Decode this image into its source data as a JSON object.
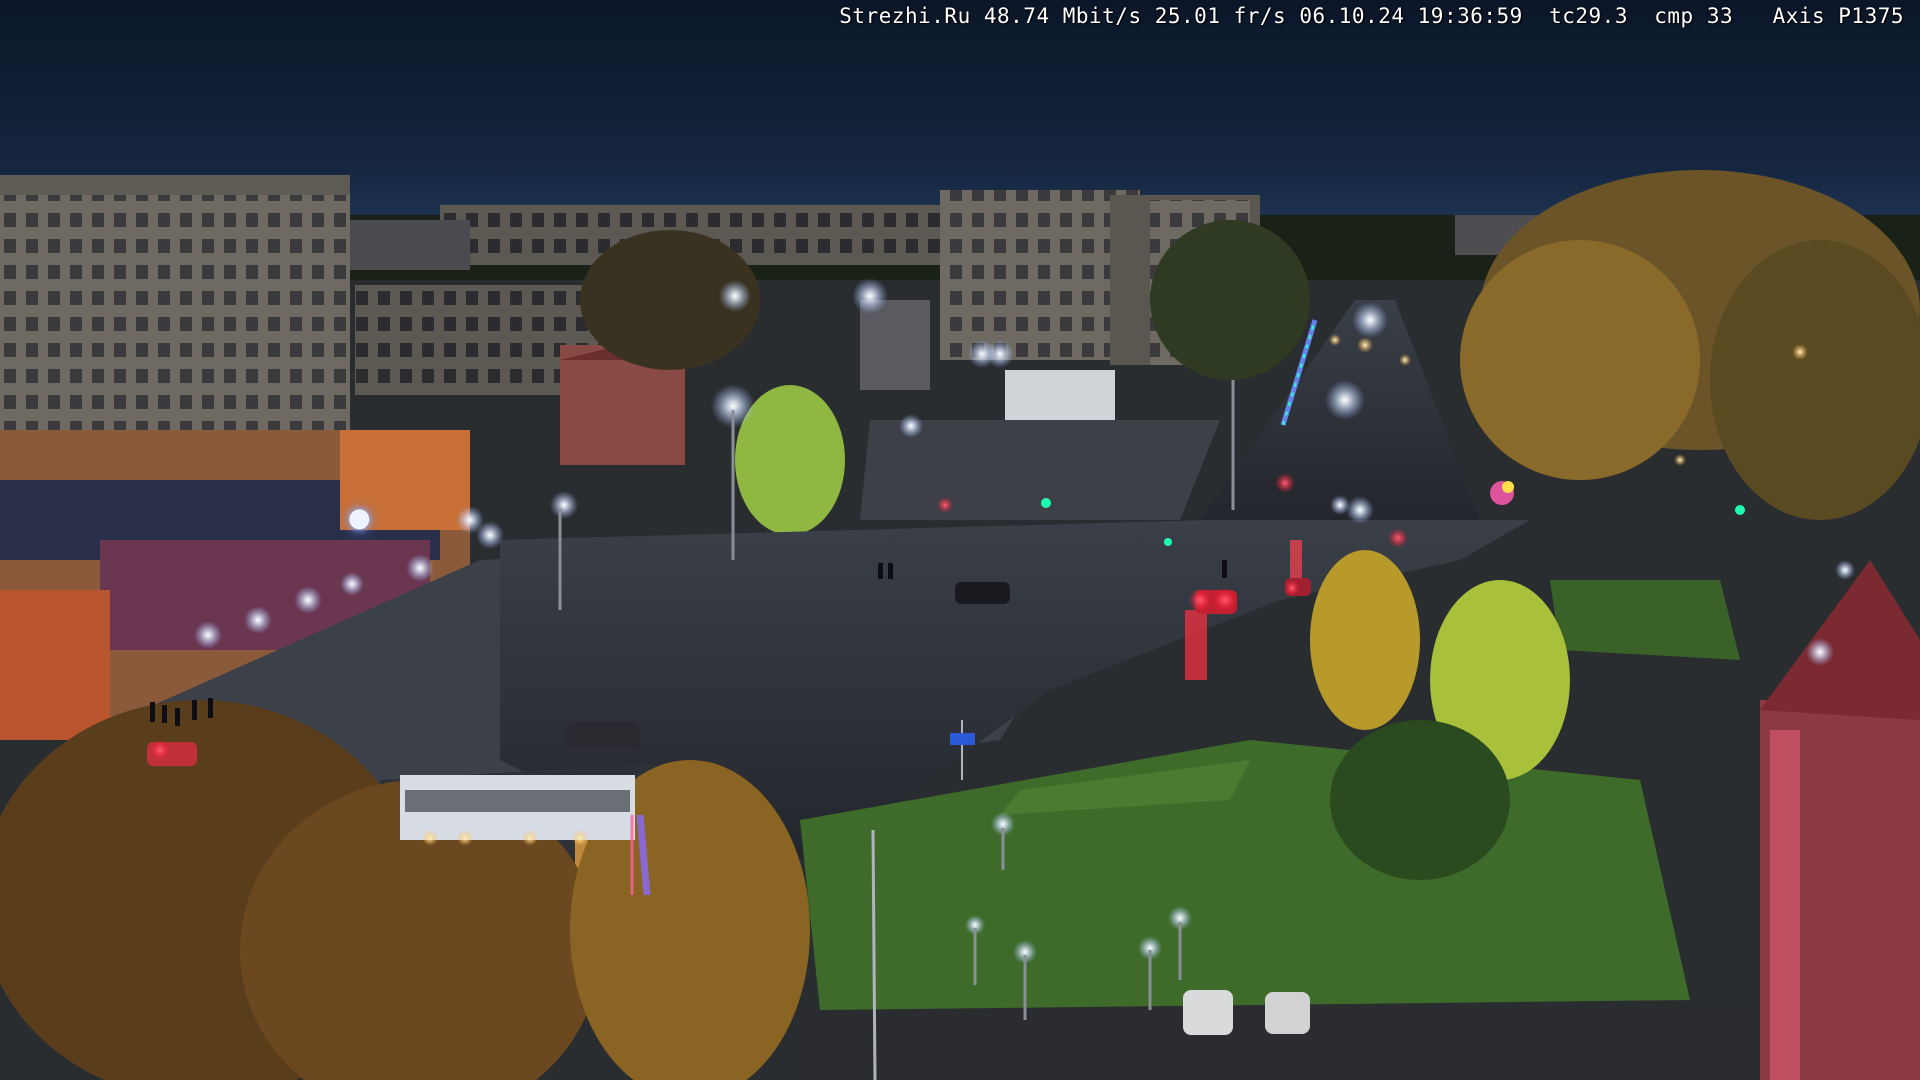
{
  "osd": {
    "site": "Strezhi.Ru",
    "bitrate": "48.74 Mbit/s",
    "framerate": "25.01 fr/s",
    "date": "06.10.24",
    "time": "19:36:59",
    "tc": "tc29.3",
    "cmp": "cmp 33",
    "camera": "Axis P1375"
  },
  "colors": {
    "sky_top": "#0d1a2e",
    "sky_horizon": "#1c3052",
    "asphalt": "#2b2f36",
    "grass": "#3f6b2a",
    "foliage_autumn": "#b8862e",
    "lamp_glow": "#e8f0ff",
    "brake_light": "#ff2a3a",
    "traffic_green": "#1dffb0"
  }
}
